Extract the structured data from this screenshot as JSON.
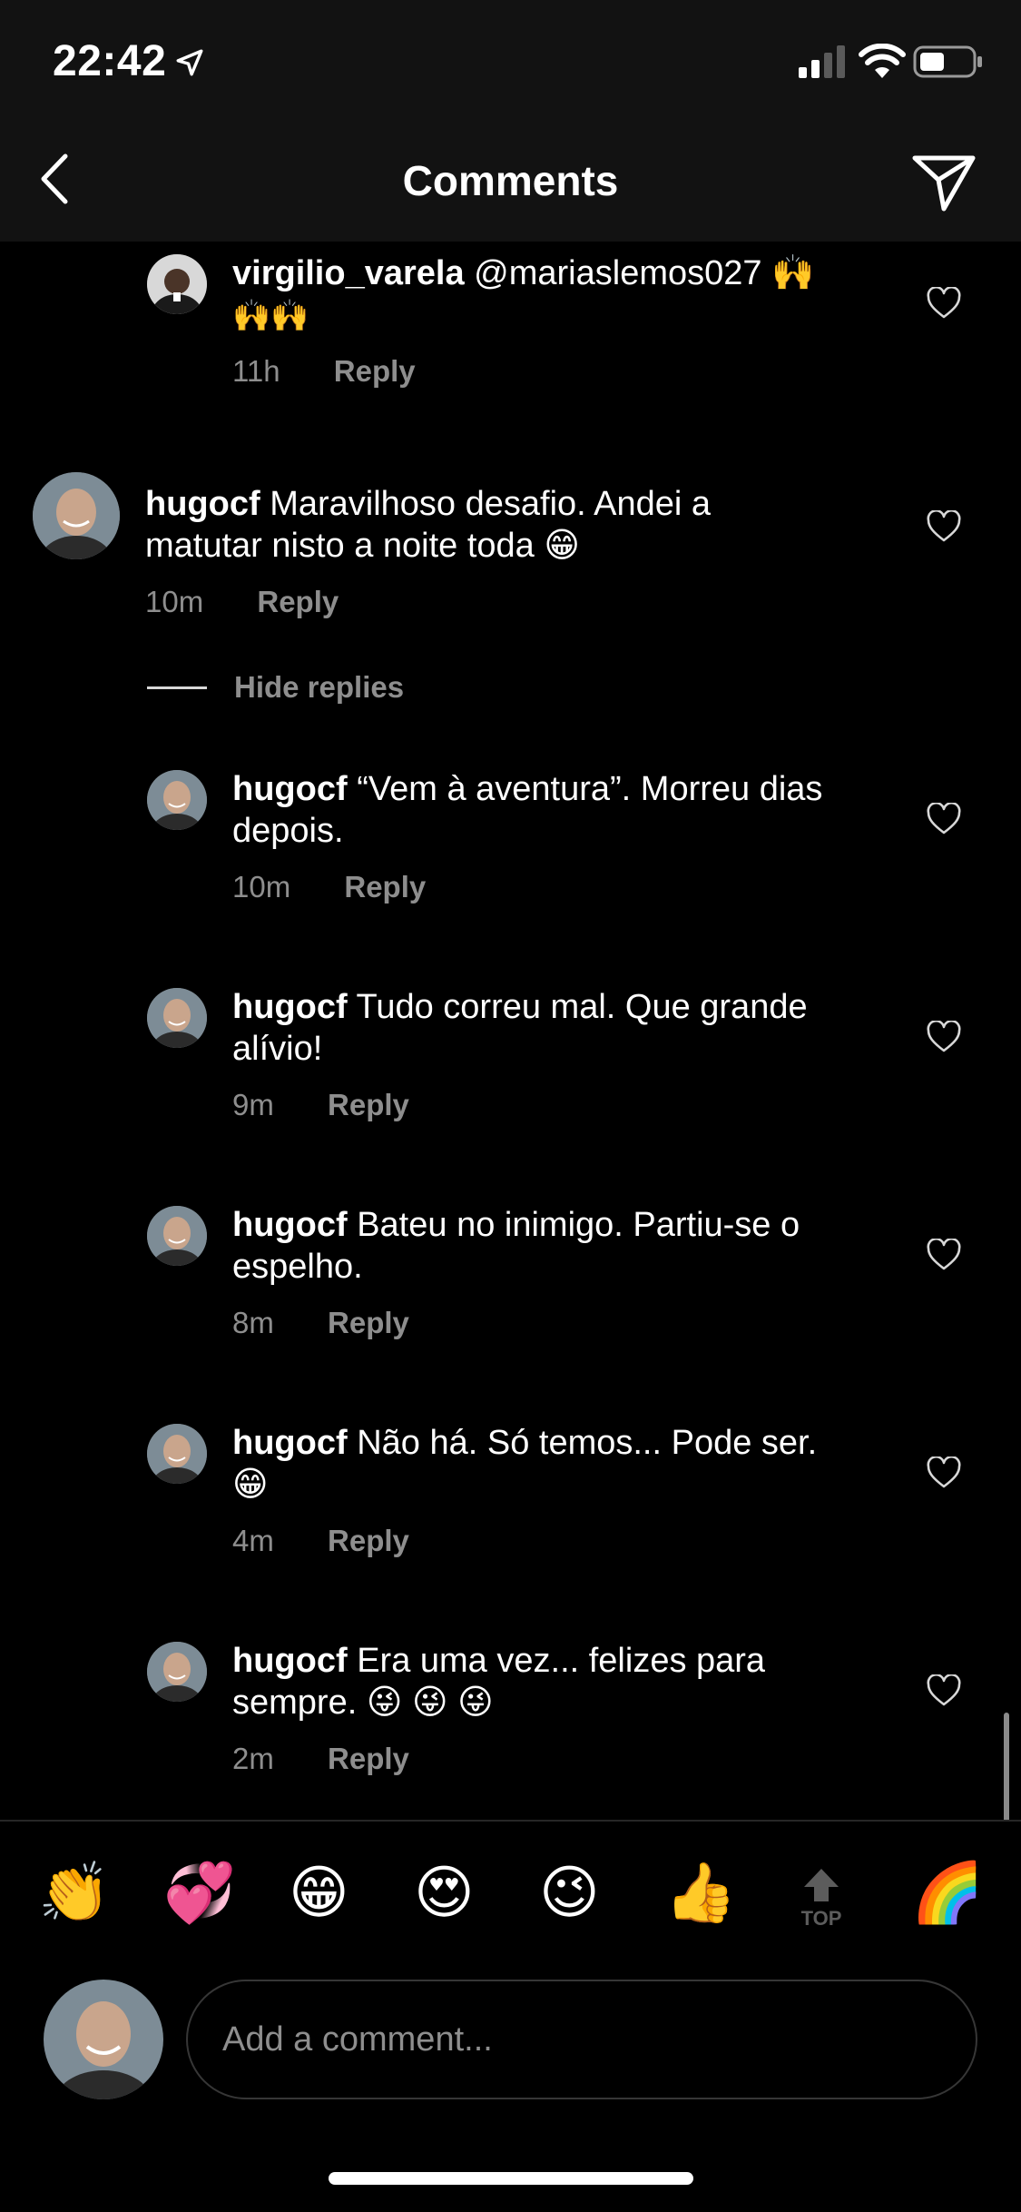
{
  "status_bar": {
    "time": "22:42",
    "icons": [
      "location-arrow-icon",
      "signal-icon",
      "wifi-icon",
      "battery-icon"
    ]
  },
  "nav": {
    "title": "Comments",
    "back_icon": "chevron-left-icon",
    "send_icon": "paper-plane-icon"
  },
  "comments": [
    {
      "username": "virgilio_varela",
      "text": "@mariaslemos027 🙌",
      "text2": "🙌🙌",
      "time": "11h",
      "reply_label": "Reply"
    },
    {
      "username": "hugocf",
      "text": "Maravilhoso desafio. Andei a",
      "text2": "matutar nisto a noite toda 😁",
      "time": "10m",
      "reply_label": "Reply"
    },
    {
      "username": "hugocf",
      "text": "“Vem à aventura”. Morreu dias",
      "text2": "depois.",
      "time": "10m",
      "reply_label": "Reply"
    },
    {
      "username": "hugocf",
      "text": "Tudo correu mal. Que grande",
      "text2": "alívio!",
      "time": "9m",
      "reply_label": "Reply"
    },
    {
      "username": "hugocf",
      "text": "Bateu no inimigo. Partiu-se o",
      "text2": "espelho.",
      "time": "8m",
      "reply_label": "Reply"
    },
    {
      "username": "hugocf",
      "text": "Não há. Só temos... Pode ser.",
      "text2": "😁",
      "time": "4m",
      "reply_label": "Reply"
    },
    {
      "username": "hugocf",
      "text": "Era uma vez... felizes para",
      "text2": "sempre. 😜 😜 😜",
      "time": "2m",
      "reply_label": "Reply"
    }
  ],
  "hide_replies_label": "Hide replies",
  "quick_emojis": [
    "👏",
    "💞",
    "😁",
    "😍",
    "😉",
    "👍",
    "🌈"
  ],
  "top_button_label": "TOP",
  "composer": {
    "placeholder": "Add a comment..."
  },
  "colors": {
    "background": "#000000",
    "bar": "#121212",
    "muted_text": "#8e8e8e",
    "border": "#363636"
  }
}
